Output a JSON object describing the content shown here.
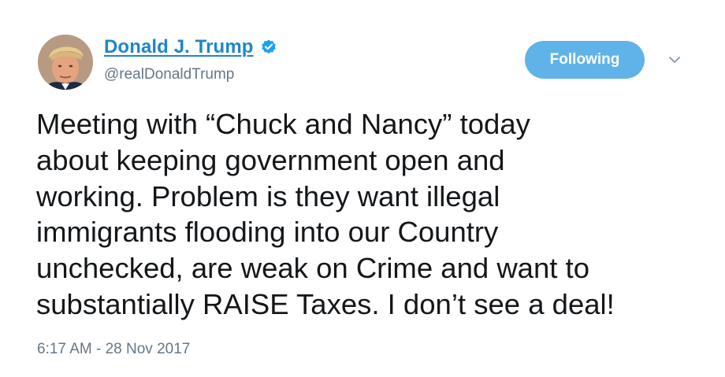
{
  "tweet": {
    "author": {
      "display_name": "Donald J. Trump",
      "handle": "@realDonaldTrump",
      "verified": true,
      "avatar_icon": "profile-photo",
      "verified_icon": "verified-badge-icon"
    },
    "follow_button": {
      "label": "Following"
    },
    "menu_icon": "chevron-down-icon",
    "text": "Meeting with “Chuck and Nancy” today\nabout keeping government open and\nworking. Problem is they want illegal\nimmigrants flooding into our Country\nunchecked, are weak on Crime and want to\nsubstantially RAISE Taxes. I don’t see a deal!",
    "timestamp": "6:17 AM - 28 Nov 2017"
  },
  "colors": {
    "link": "#1f86c8",
    "button": "#60b3e8",
    "secondary_text": "#657786",
    "body_text": "#14171a"
  }
}
